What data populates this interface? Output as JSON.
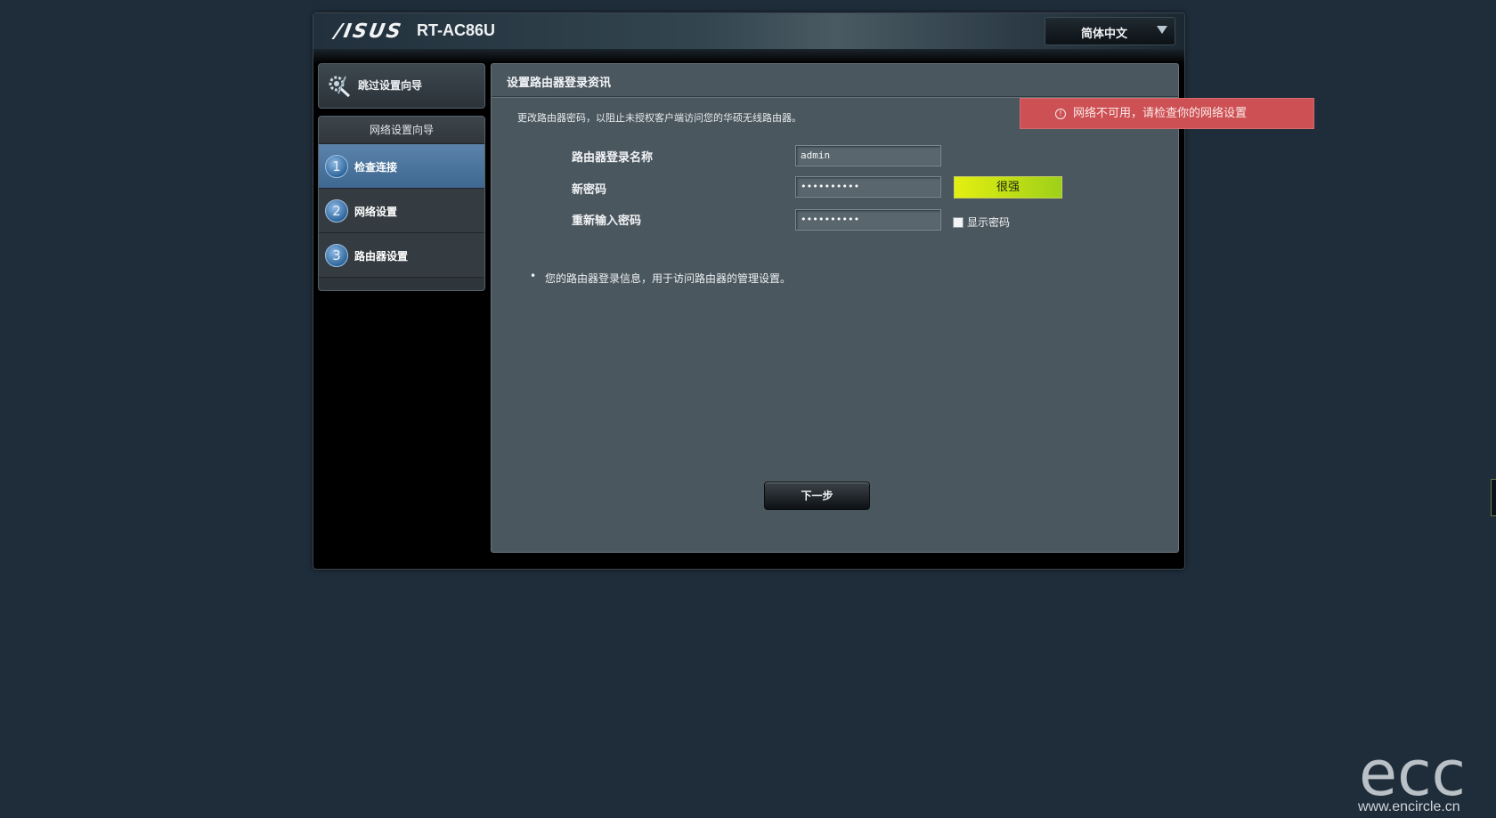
{
  "header": {
    "logo": "/ISUS",
    "model": "RT-AC86U",
    "language_selected": "简体中文"
  },
  "sidebar": {
    "skip_label": "跳过设置向导",
    "wizard_title": "网络设置向导",
    "steps": [
      {
        "number": "1",
        "label": "检查连接",
        "active": true
      },
      {
        "number": "2",
        "label": "网络设置",
        "active": false
      },
      {
        "number": "3",
        "label": "路由器设置",
        "active": false
      }
    ]
  },
  "panel": {
    "title": "设置路由器登录资讯",
    "description": "更改路由器密码，以阻止未授权客户端访问您的华硕无线路由器。",
    "fields": {
      "username_label": "路由器登录名称",
      "username_value": "admin",
      "password_label": "新密码",
      "password_value": "••••••••••",
      "password_strength": "很强",
      "confirm_label": "重新输入密码",
      "confirm_value": "••••••••••",
      "show_password_label": "显示密码"
    },
    "note_bullet": "•",
    "note": "您的路由器登录信息，用于访问路由器的管理设置。",
    "next_button": "下一步"
  },
  "alert": {
    "icon": "info-icon",
    "text": "网络不可用，请检查你的网络设置"
  },
  "watermark": {
    "logo": "ecc",
    "url": "www.encircle.cn"
  },
  "colors": {
    "background": "#1f2d3b",
    "panel": "#4b575e",
    "alert": "#cd5154",
    "active_step": "#4a73a0",
    "strength_bar": "#c7e216"
  }
}
